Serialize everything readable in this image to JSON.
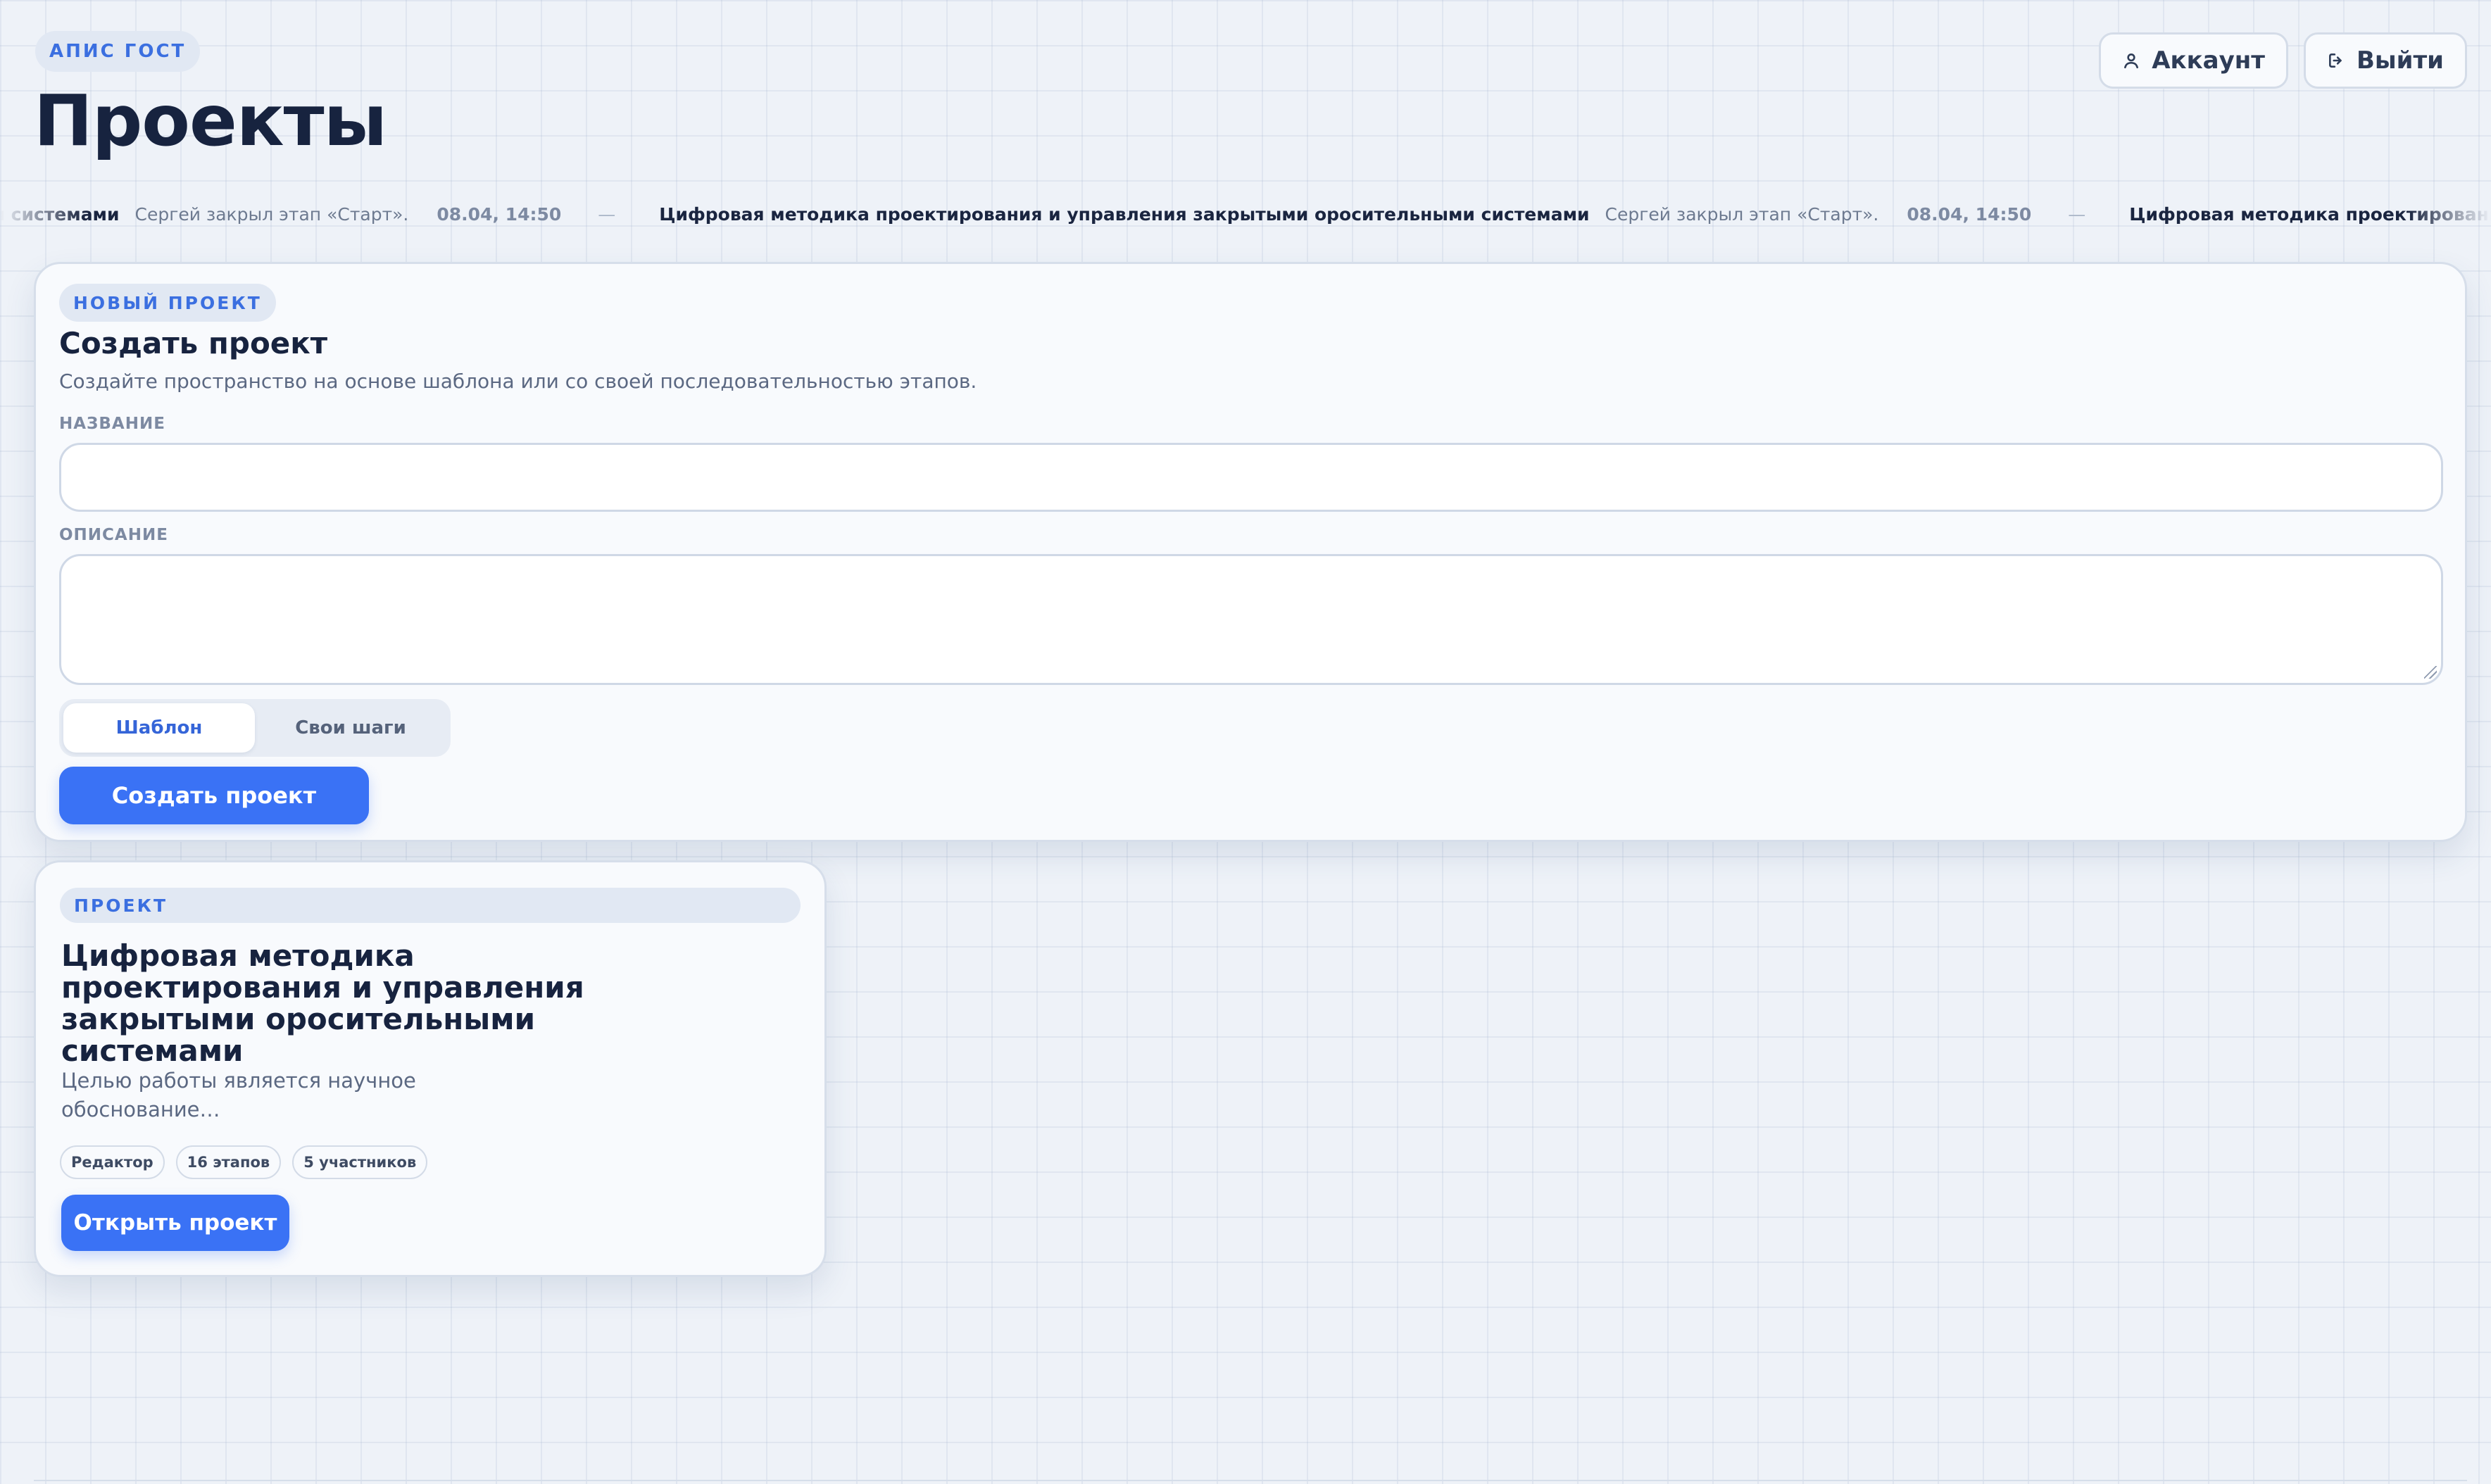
{
  "header": {
    "brand": "АПИС ГОСТ",
    "title": "Проекты",
    "account_label": "Аккаунт",
    "logout_label": "Выйти",
    "account_icon": "user-icon",
    "logout_icon": "logout-icon"
  },
  "ticker": {
    "items": [
      {
        "title": "…ми системами",
        "event": "Сергей закрыл этап «Старт».",
        "time": "08.04, 14:50"
      },
      {
        "title": "Цифровая методика проектирования и управления закрытыми оросительными системами",
        "event": "Сергей закрыл этап «Старт».",
        "time": "08.04, 14:50"
      },
      {
        "title": "Цифровая методика проектирования и управления закрытыми оросительными системами",
        "event": "",
        "time": ""
      }
    ],
    "separator": "—"
  },
  "create": {
    "badge": "НОВЫЙ ПРОЕКТ",
    "title": "Создать проект",
    "subtitle": "Создайте пространство на основе шаблона или со своей последовательностью этапов.",
    "name_label": "НАЗВАНИЕ",
    "name_value": "",
    "description_label": "ОПИСАНИЕ",
    "description_value": "",
    "mode_template": "Шаблон",
    "mode_custom": "Свои шаги",
    "mode_selected": "Шаблон",
    "submit_label": "Создать проект"
  },
  "project": {
    "badge": "ПРОЕКТ",
    "title": "Цифровая методика проектирования и управления закрытыми оросительными системами",
    "description_line1": "Целью работы является научное",
    "description_line2": "обоснование…",
    "chips": [
      "Редактор",
      "16 этапов",
      "5 участников"
    ],
    "open_label": "Открыть проект"
  },
  "colors": {
    "accent": "#3a72f5",
    "background": "#eef2f8",
    "title": "#17233f"
  }
}
